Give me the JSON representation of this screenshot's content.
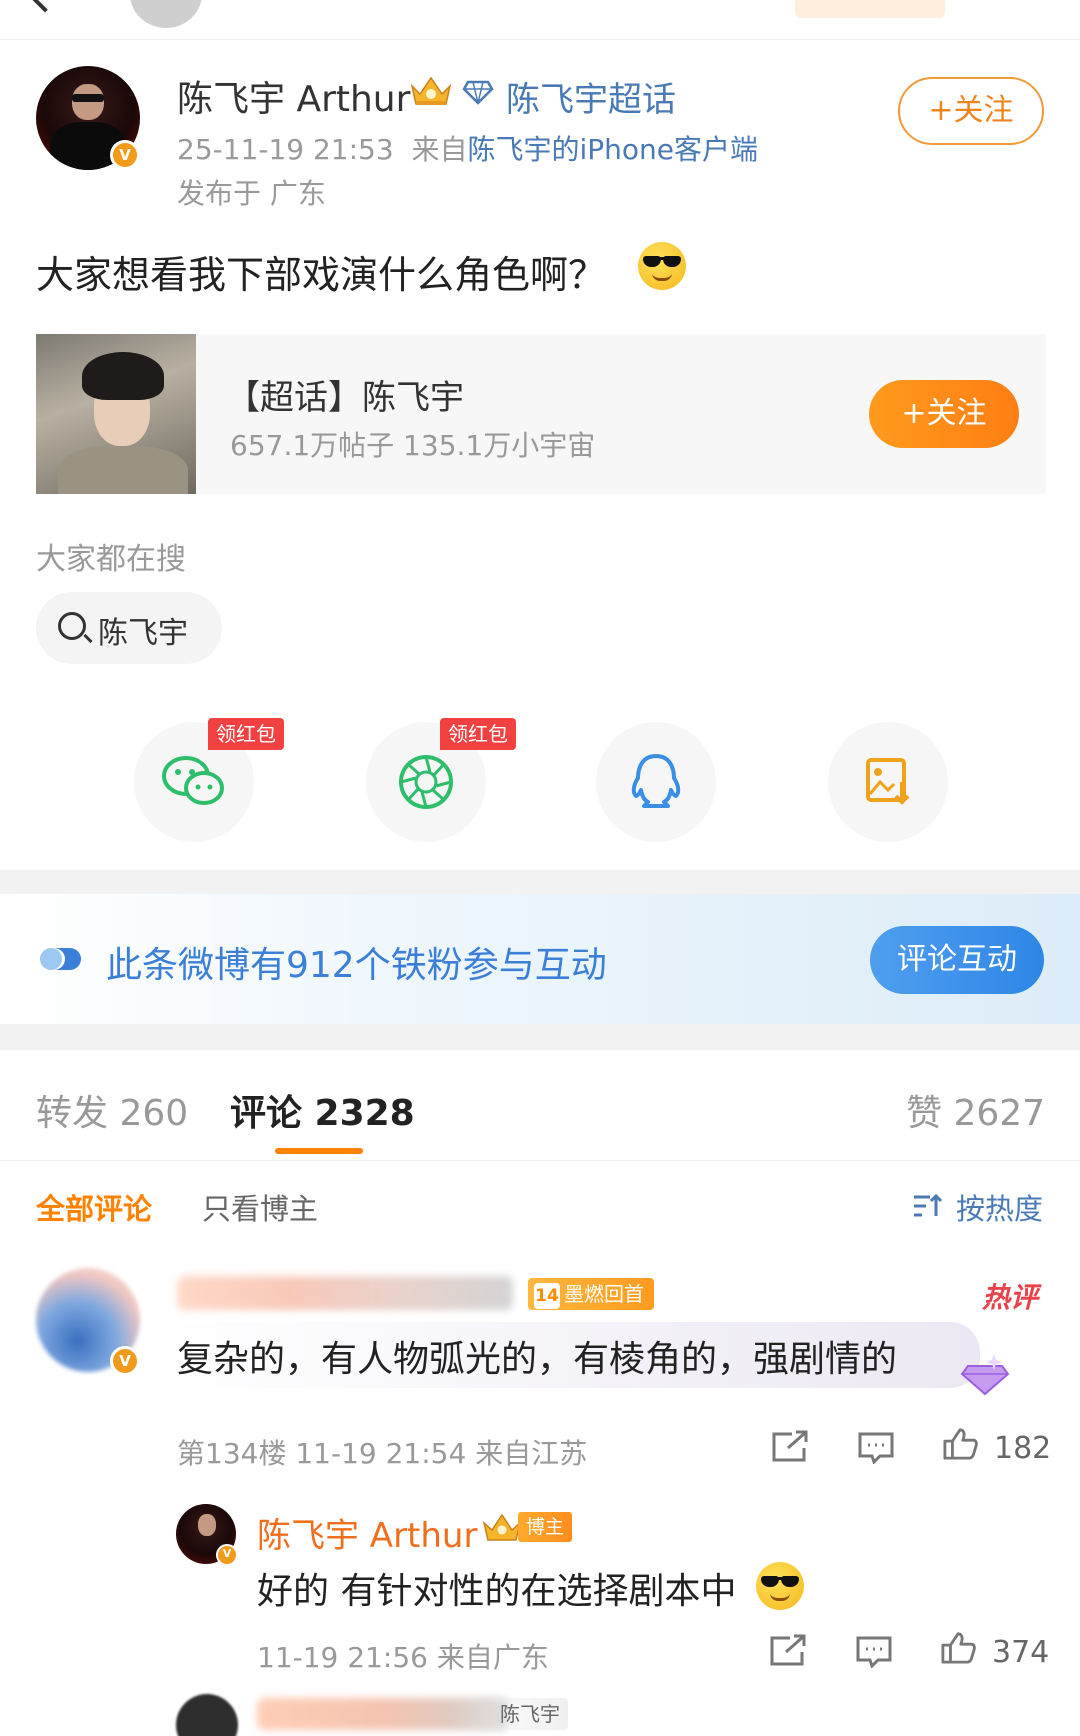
{
  "post": {
    "author": "陈飞宇 Arthur",
    "supertopic_link": "陈飞宇超话",
    "time": "25-11-19 21:53",
    "source_prefix": "来自",
    "source": "陈飞宇的iPhone客户端",
    "location": "发布于 广东",
    "follow_label": "+关注",
    "text": "大家想看我下部戏演什么角色啊？"
  },
  "topic_card": {
    "title": "【超话】陈飞宇",
    "stats": "657.1万帖子 135.1万小宇宙",
    "follow_label": "+关注"
  },
  "search": {
    "hint": "大家都在搜",
    "chip": "陈飞宇"
  },
  "share": {
    "redpack_label": "领红包",
    "items": [
      "wechat-icon",
      "moments-icon",
      "qq-icon",
      "save-image-icon"
    ]
  },
  "fan_banner": {
    "text": "此条微博有912个铁粉参与互动",
    "button": "评论互动"
  },
  "tabs": {
    "repost": "转发 260",
    "comment": "评论 2328",
    "like": "赞 2627"
  },
  "filters": {
    "all": "全部评论",
    "owner": "只看博主",
    "sort": "按热度"
  },
  "comments": [
    {
      "fan_badge_level": "14",
      "fan_badge_text": "墨燃回首",
      "hot_label": "热评",
      "text": "复杂的，有人物弧光的，有棱角的，强剧情的",
      "meta": "第134楼 11-19 21:54 来自江苏",
      "likes": "182",
      "reply": {
        "author": "陈飞宇 Arthur",
        "badge": "博主",
        "text": "好的 有针对性的在选择剧本中",
        "meta": "11-19 21:56 来自广东",
        "likes": "374"
      }
    }
  ],
  "next_comment_tag": "陈飞宇",
  "colors": {
    "accent_orange": "#ff8200",
    "link_blue": "#4a7ab5",
    "fan_blue": "#3b7fd8",
    "hot_red": "#e8424a"
  }
}
